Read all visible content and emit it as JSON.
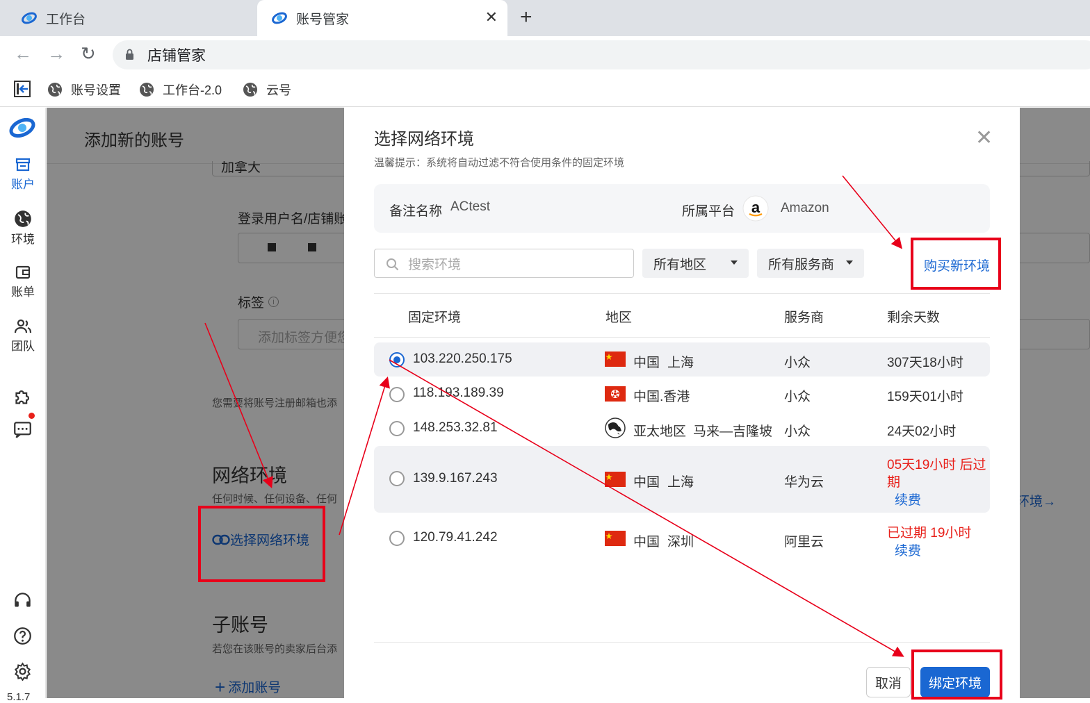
{
  "browser": {
    "tabs": [
      {
        "label": "工作台"
      },
      {
        "label": "账号管家"
      }
    ],
    "address": "店铺管家",
    "bookmarks": [
      {
        "label": "账号设置"
      },
      {
        "label": "工作台-2.0"
      },
      {
        "label": "云号"
      }
    ]
  },
  "sidenav": {
    "items": [
      {
        "label": "账户",
        "icon": "store-icon"
      },
      {
        "label": "环境",
        "icon": "globe-icon"
      },
      {
        "label": "账单",
        "icon": "wallet-icon"
      },
      {
        "label": "团队",
        "icon": "team-icon"
      }
    ],
    "version": "5.1.7"
  },
  "background": {
    "page_title": "添加新的账号",
    "country_value": "加拿大",
    "login_label": "登录用户名/店铺账",
    "tags_label": "标签",
    "tags_placeholder": "添加标签方便您",
    "email_note": "您需要将账号注册邮箱也添",
    "network_title": "网络环境",
    "network_desc": "任何时候、任何设备、任何",
    "select_network": "选择网络环境",
    "right_link": "环境→",
    "sub_title": "子账号",
    "sub_desc": "若您在该账号的卖家后台添",
    "add_account": "添加账号"
  },
  "modal": {
    "title": "选择网络环境",
    "hint": "温馨提示：系统将自动过滤不符合使用条件的固定环境",
    "remark_label": "备注名称",
    "remark_value": "ACtest",
    "platform_label": "所属平台",
    "platform_value": "Amazon",
    "search_placeholder": "搜索环境",
    "region_filter": "所有地区",
    "provider_filter": "所有服务商",
    "buy_new": "购买新环境",
    "columns": [
      "固定环境",
      "地区",
      "服务商",
      "剩余天数"
    ],
    "rows": [
      {
        "ip": "103.220.250.175",
        "country": "中国",
        "city": "上海",
        "provider": "小众",
        "remaining": "307天18小时",
        "selected": true
      },
      {
        "ip": "118.193.189.39",
        "country": "中国.香港",
        "city": "",
        "provider": "小众",
        "remaining": "159天01小时",
        "selected": false
      },
      {
        "ip": "148.253.32.81",
        "country": "亚太地区",
        "city": "马来—吉隆坡",
        "provider": "小众",
        "remaining": "24天02小时",
        "selected": false
      },
      {
        "ip": "139.9.167.243",
        "country": "中国",
        "city": "上海",
        "provider": "华为云",
        "remaining_line1": "05天19小时 后过",
        "remaining_line2": "期",
        "renew": "续费",
        "selected": false
      },
      {
        "ip": "120.79.41.242",
        "country": "中国",
        "city": "深圳",
        "provider": "阿里云",
        "remaining": "已过期 19小时",
        "renew": "续费",
        "selected": false
      }
    ],
    "cancel": "取消",
    "confirm": "绑定环境"
  },
  "colors": {
    "primary": "#1a67d2",
    "danger": "#e8201a",
    "annotation": "#e8001a"
  }
}
